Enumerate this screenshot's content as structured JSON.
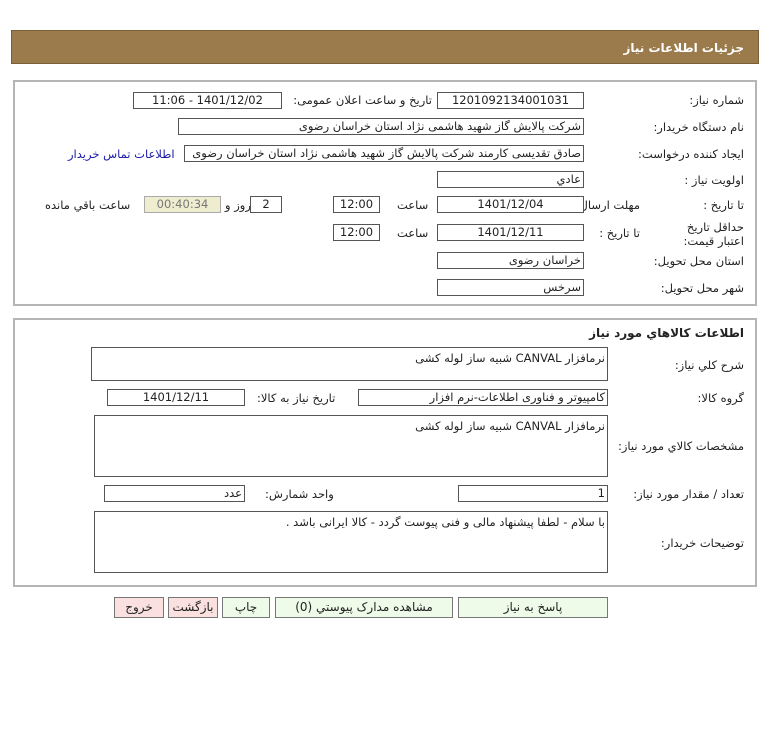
{
  "header": {
    "title": "جزئیات اطلاعات نیاز"
  },
  "info": {
    "need_number_label": "شماره نیاز:",
    "need_number": "1201092134001031",
    "announce_label": "تاریخ و ساعت اعلان عمومی:",
    "announce_value": "1401/12/02 - 11:06",
    "buyer_label": "نام دستگاه خریدار:",
    "buyer_value": "شرکت پالایش گاز شهید هاشمی نژاد   استان خراسان رضوی",
    "creator_label": "ایجاد کننده درخواست:",
    "creator_value": "صادق تقدیسی کارمند شرکت پالایش گاز شهید هاشمی نژاد   استان خراسان رضوی",
    "contact_link": "اطلاعات تماس خریدار",
    "priority_label": "اولویت نیاز :",
    "priority_value": "عادي",
    "deadline_label": "مهلت ارسال پاسخ:",
    "to_date_label": "تا تاریخ :",
    "deadline_date": "1401/12/04",
    "time_label": "ساعت",
    "deadline_time": "12:00",
    "days_value": "2",
    "days_label": "روز و",
    "remaining_time": "00:40:34",
    "remaining_label": "ساعت باقي مانده",
    "validity_label": "حداقل تاريخ اعتبار قیمت:",
    "validity_date": "1401/12/11",
    "validity_time": "12:00",
    "province_label": "استان محل تحویل:",
    "province_value": "خراسان رضوی",
    "city_label": "شهر محل تحویل:",
    "city_value": "سرخس"
  },
  "goods": {
    "title": "اطلاعات کالاهاي مورد نیاز",
    "summary_label": "شرح کلي نیاز:",
    "summary_value": "نرمافزار CANVAL شبیه ساز لوله کشی",
    "group_label": "گروه کالا:",
    "group_value": "کامپیوتر و فناوری اطلاعات-نرم افزار",
    "need_date_label": "تاریخ نیاز به کالا:",
    "need_date_value": "1401/12/11",
    "spec_label": "مشخصات کالاي مورد نیاز:",
    "spec_value": "نرمافزار CANVAL شبیه ساز لوله کشی",
    "qty_label": "تعداد / مقدار مورد نیاز:",
    "qty_value": "1",
    "unit_label": "واحد شمارش:",
    "unit_value": "عدد",
    "notes_label": "توضیحات خریدار:",
    "notes_value": "با سلام - لطفا پیشنهاد مالی و فنی  پیوست گردد - کالا ایرانی باشد ."
  },
  "buttons": {
    "reply": "پاسخ به نیاز",
    "attachments": "مشاهده مدارک پیوستي (0)",
    "print": "چاپ",
    "back": "بازگشت",
    "exit": "خروج"
  },
  "colors": {
    "header": "#9b7b4b",
    "remaining_bg": "#efedd0",
    "green_btn": "#eefbe9",
    "red_btn": "#fbe0e0"
  }
}
